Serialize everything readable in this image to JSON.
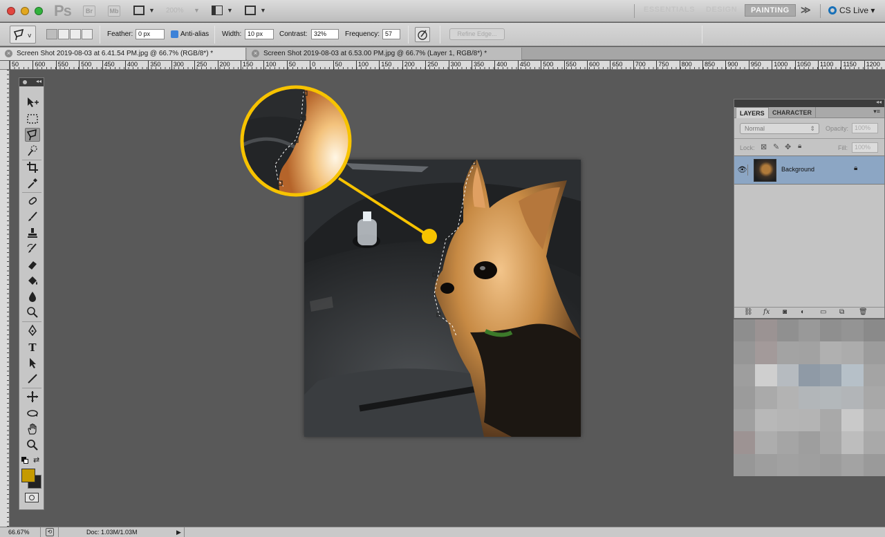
{
  "app": {
    "logo": "Ps",
    "bridge_btn": "Br",
    "minibridge_btn": "Mb",
    "zoom": "200%",
    "workspaces": [
      "ESSENTIALS",
      "DESIGN",
      "PAINTING"
    ],
    "active_workspace": "PAINTING",
    "more": "≫",
    "cs_live": "CS Live"
  },
  "options": {
    "feather_label": "Feather:",
    "feather_value": "0 px",
    "antialias_label": "Anti-alias",
    "width_label": "Width:",
    "width_value": "10 px",
    "contrast_label": "Contrast:",
    "contrast_value": "32%",
    "frequency_label": "Frequency:",
    "frequency_value": "57",
    "refine_edge": "Refine Edge..."
  },
  "tabs": [
    {
      "title": "Screen Shot 2019-08-03 at 6.41.54 PM.jpg @ 66.7% (RGB/8*) *",
      "active": true
    },
    {
      "title": "Screen Shot 2019-08-03 at 6.53.00 PM.jpg @ 66.7% (Layer 1, RGB/8*) *",
      "active": false
    }
  ],
  "ruler_top": [
    "50",
    "600",
    "550",
    "500",
    "450",
    "400",
    "350",
    "300",
    "250",
    "200",
    "150",
    "100",
    "50",
    "0",
    "50",
    "100",
    "150",
    "200",
    "250",
    "300",
    "350",
    "400",
    "450",
    "500",
    "550",
    "600",
    "650",
    "700",
    "750",
    "800",
    "850",
    "900",
    "950",
    "1000",
    "1050",
    "1100",
    "1150",
    "1200"
  ],
  "layers_panel": {
    "tabs": [
      "LAYERS",
      "CHARACTER"
    ],
    "blend_mode": "Normal",
    "opacity_label": "Opacity:",
    "opacity_value": "100%",
    "lock_label": "Lock:",
    "fill_label": "Fill:",
    "fill_value": "100%",
    "layers": [
      {
        "name": "Background",
        "locked": true,
        "visible": true
      }
    ]
  },
  "status": {
    "zoom": "66.67%",
    "doc": "Doc: 1.03M/1.03M"
  },
  "colors": {
    "foreground": "#c59a00",
    "background": "#222222",
    "callout": "#f7c300",
    "selected_layer": "#8ca6c4"
  },
  "icons": [
    "move-icon",
    "marquee-icon",
    "magnetic-lasso-icon",
    "quick-selection-icon",
    "crop-icon",
    "eyedropper-icon",
    "healing-brush-icon",
    "brush-icon",
    "clone-stamp-icon",
    "history-brush-icon",
    "eraser-icon",
    "paint-bucket-icon",
    "blur-icon",
    "dodge-icon",
    "pen-icon",
    "type-icon",
    "path-selection-icon",
    "line-icon",
    "3d-rotate-icon",
    "3d-orbit-icon",
    "hand-icon",
    "zoom-icon"
  ]
}
